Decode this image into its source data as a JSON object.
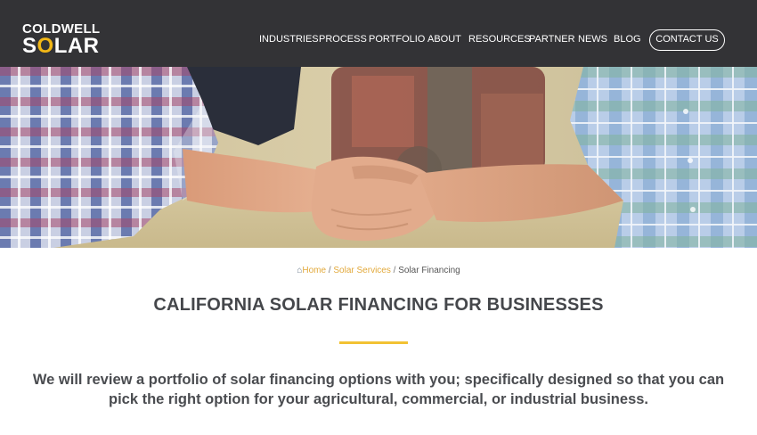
{
  "header": {
    "logo": {
      "top": "COLDWELL",
      "bottom_pre": "S",
      "bottom_o": "O",
      "bottom_post": "LAR"
    },
    "nav": [
      "INDUSTRIES",
      "PROCESS",
      "PORTFOLIO",
      "ABOUT",
      "RESOURCES",
      "PARTNER",
      "NEWS",
      "BLOG"
    ],
    "contact_label": "CONTACT US"
  },
  "breadcrumb": {
    "home": "Home",
    "separator": "/",
    "parent": "Solar Services",
    "current": "Solar Financing"
  },
  "main": {
    "title": "CALIFORNIA SOLAR FINANCING FOR BUSINESSES",
    "intro": "We will review a portfolio of solar financing options with you; specifically designed so that you can pick the right option for your agricultural, commercial, or industrial business."
  },
  "colors": {
    "header_bg": "#333336",
    "accent": "#f2b716",
    "breadcrumb_link": "#e2a93b",
    "title_rule": "#f2c233"
  },
  "icons": [
    "home-icon"
  ]
}
